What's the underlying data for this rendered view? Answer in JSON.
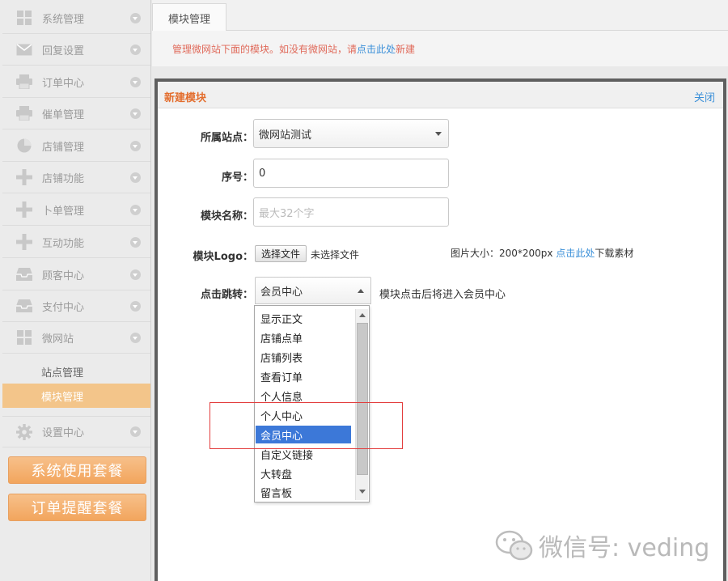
{
  "sidebar": {
    "items": [
      {
        "label": "系统管理",
        "icon": "grid-icon"
      },
      {
        "label": "回复设置",
        "icon": "mail-icon"
      },
      {
        "label": "订单中心",
        "icon": "printer-icon"
      },
      {
        "label": "催单管理",
        "icon": "printer-icon"
      },
      {
        "label": "店铺管理",
        "icon": "pie-chart-icon"
      },
      {
        "label": "店铺功能",
        "icon": "plus-icon"
      },
      {
        "label": "卜单管理",
        "icon": "plus-icon"
      },
      {
        "label": "互动功能",
        "icon": "plus-icon"
      },
      {
        "label": "顾客中心",
        "icon": "inbox-icon"
      },
      {
        "label": "支付中心",
        "icon": "inbox-icon"
      },
      {
        "label": "微网站",
        "icon": "grid-icon"
      }
    ],
    "sub_items": [
      {
        "label": "站点管理"
      },
      {
        "label": "模块管理"
      }
    ],
    "settings": {
      "label": "设置中心",
      "icon": "gear-icon"
    },
    "buttons": [
      {
        "label": "系统使用套餐"
      },
      {
        "label": "订单提醒套餐"
      }
    ]
  },
  "tabs": [
    {
      "label": "模块管理"
    }
  ],
  "notice": {
    "prefix": "管理微网站下面的模块。如没有微网站，请",
    "link": "点击此处",
    "suffix": "新建"
  },
  "modal": {
    "title": "新建模块",
    "close": "关闭",
    "site_label": "所属站点：",
    "site_value": "微网站测试",
    "order_label": "序号：",
    "order_value": "0",
    "name_label": "模块名称：",
    "name_placeholder": "最大32个字",
    "logo_label": "模块Logo：",
    "file_button": "选择文件",
    "file_status": "未选择文件",
    "image_size": "图片大小：200*200px",
    "download_link": "点击此处",
    "download_suffix": "下载素材",
    "jump_label": "点击跳转：",
    "jump_value": "会员中心",
    "jump_hint": "模块点击后将进入会员中心",
    "options": [
      "显示正文",
      "店铺点单",
      "店铺列表",
      "查看订单",
      "个人信息",
      "个人中心",
      "会员中心",
      "自定义链接",
      "大转盘",
      "留言板"
    ],
    "selected_option": "会员中心"
  },
  "watermark": {
    "text": "微信号: veding"
  },
  "colors": {
    "accent": "#e36d2d",
    "link": "#3a8fd8",
    "selected": "#3c78d8",
    "highlight": "#e23c3c",
    "orange_button": "#f2a55d"
  }
}
